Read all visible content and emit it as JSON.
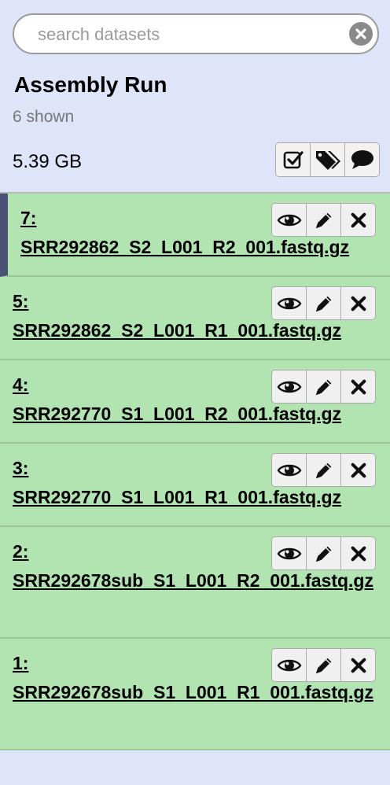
{
  "search": {
    "placeholder": "search datasets"
  },
  "history": {
    "name": "Assembly Run",
    "shown": "6 shown",
    "size": "5.39 GB"
  },
  "datasets": [
    {
      "hid": "7:",
      "name": "SRR292862_S2_L001_R2_001.fastq.gz",
      "state_color": "#b1e4b1",
      "current": true
    },
    {
      "hid": "5:",
      "name": "SRR292862_S2_L001_R1_001.fastq.gz",
      "state_color": "#b1e4b1"
    },
    {
      "hid": "4:",
      "name": "SRR292770_S1_L001_R2_001.fastq.gz",
      "state_color": "#b1e4b1"
    },
    {
      "hid": "3:",
      "name": "SRR292770_S1_L001_R1_001.fastq.gz",
      "state_color": "#b1e4b1"
    },
    {
      "hid": "2:",
      "name": "SRR292678sub_S1_L001_R2_001.fastq.gz",
      "state_color": "#b1e4b1"
    },
    {
      "hid": "1:",
      "name": "SRR292678sub_S1_L001_R1_001.fastq.gz",
      "state_color": "#b1e4b1"
    }
  ],
  "icons": {
    "clear": "clear-icon",
    "select": "check-square-icon",
    "tags": "tags-icon",
    "annotation": "comment-icon",
    "view": "eye-icon",
    "edit": "pencil-icon",
    "delete": "x-icon"
  }
}
